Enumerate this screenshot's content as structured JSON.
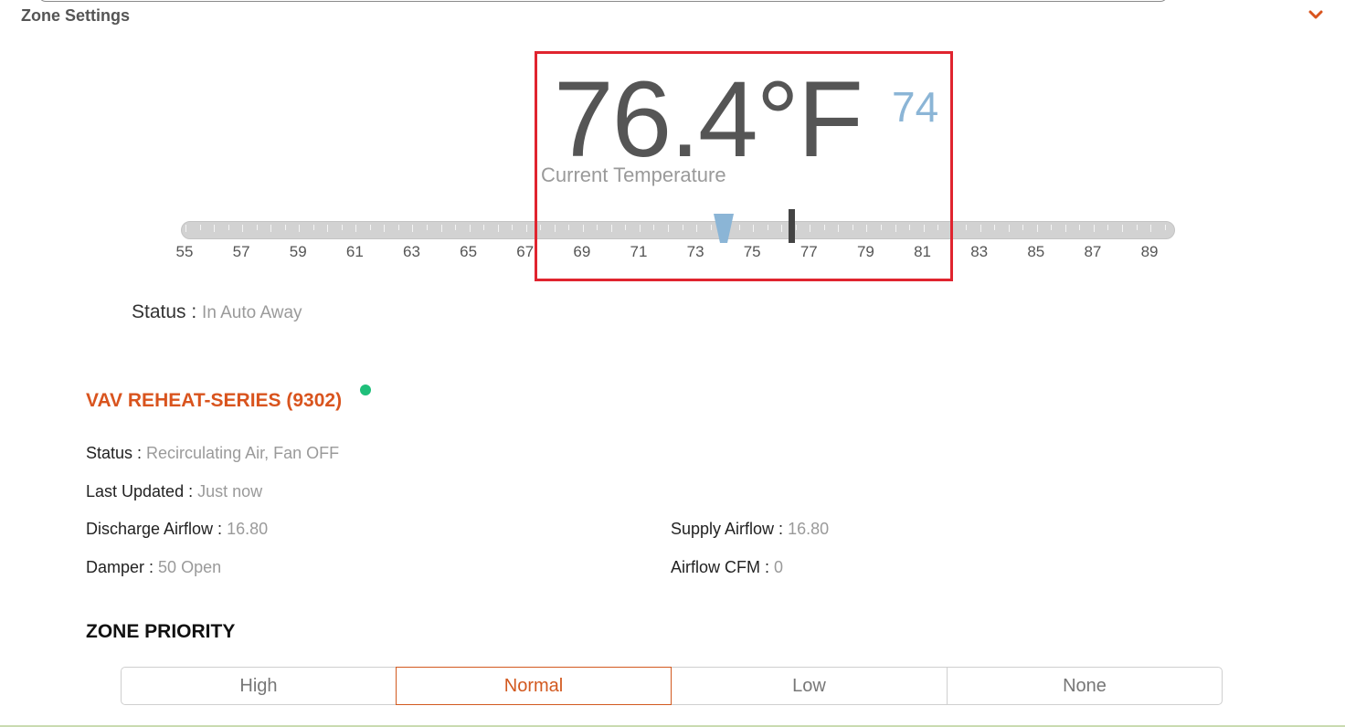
{
  "section": {
    "title": "Zone Settings",
    "toggle_icon": "chevron-down-icon",
    "accent": "#d9541e"
  },
  "thermostat": {
    "current_temp": "76.4°F",
    "setpoint": "74",
    "current_label": "Current Temperature",
    "slider": {
      "min": 55,
      "max": 90,
      "setpoint_value": 74,
      "current_value": 76.4,
      "tick_labels": [
        "55",
        "57",
        "59",
        "61",
        "63",
        "65",
        "67",
        "69",
        "71",
        "73",
        "75",
        "77",
        "79",
        "81",
        "83",
        "85",
        "87",
        "89"
      ]
    },
    "colors": {
      "readout": "#555555",
      "setpoint": "#8bb5d6",
      "highlight": "#e0242f"
    }
  },
  "zone_status": {
    "label": "Status :",
    "value": "In Auto Away"
  },
  "device": {
    "title": "VAV REHEAT-SERIES (9302)",
    "online_color": "#1fbf7a",
    "status": {
      "label": "Status :",
      "value": "Recirculating Air, Fan OFF"
    },
    "last_updated": {
      "label": "Last Updated :",
      "value": "Just now"
    },
    "discharge_airflow": {
      "label": "Discharge Airflow :",
      "value": "16.80"
    },
    "supply_airflow": {
      "label": "Supply Airflow :",
      "value": "16.80"
    },
    "damper": {
      "label": "Damper :",
      "value": "50 Open"
    },
    "airflow_cfm": {
      "label": "Airflow CFM :",
      "value": "0"
    }
  },
  "priority": {
    "title": "ZONE PRIORITY",
    "options": [
      "High",
      "Normal",
      "Low",
      "None"
    ],
    "selected": "Normal"
  }
}
